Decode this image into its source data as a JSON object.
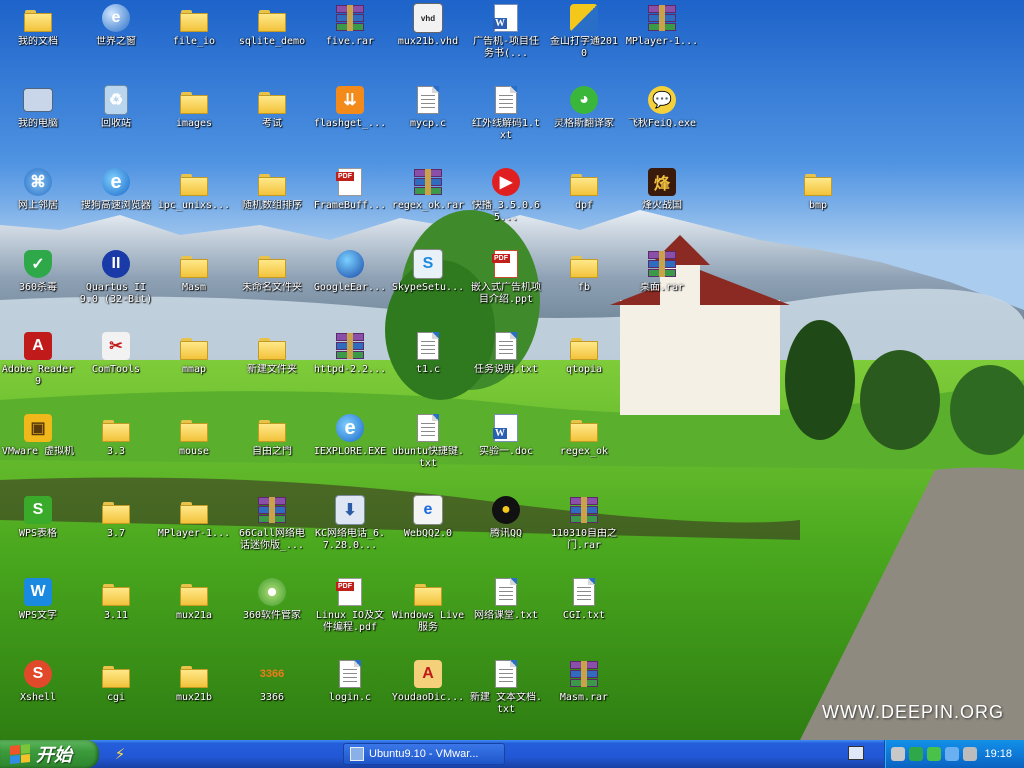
{
  "wallpaper": {
    "watermark": "WWW.DEEPIN.ORG"
  },
  "icons": [
    {
      "label": "我的文档",
      "kind": "mydocs"
    },
    {
      "label": "世界之窗",
      "kind": "browser-globe"
    },
    {
      "label": "file_io",
      "kind": "folder"
    },
    {
      "label": "sqlite_demo",
      "kind": "folder"
    },
    {
      "label": "five.rar",
      "kind": "rar"
    },
    {
      "label": "mux21b.vhd",
      "kind": "vhd"
    },
    {
      "label": "广告机-项目任务书(...",
      "kind": "word"
    },
    {
      "label": "金山打字通2010",
      "kind": "typing"
    },
    {
      "label": "MPlayer-1...",
      "kind": "rar"
    },
    {
      "label": "我的电脑",
      "kind": "computer"
    },
    {
      "label": "回收站",
      "kind": "recycle"
    },
    {
      "label": "images",
      "kind": "folder"
    },
    {
      "label": "考试",
      "kind": "folder"
    },
    {
      "label": "flashget_...",
      "kind": "flashget"
    },
    {
      "label": "mycp.c",
      "kind": "text"
    },
    {
      "label": "红外线解码1.txt",
      "kind": "text"
    },
    {
      "label": "灵格斯翻译家",
      "kind": "parrot"
    },
    {
      "label": "飞秋FeiQ.exe",
      "kind": "feiq"
    },
    {
      "label": "网上邻居",
      "kind": "network"
    },
    {
      "label": "搜狗高速浏览器",
      "kind": "ie"
    },
    {
      "label": "ipc_unixs...",
      "kind": "folder"
    },
    {
      "label": "随机数组排序",
      "kind": "folder"
    },
    {
      "label": "FrameBuff...",
      "kind": "pdf"
    },
    {
      "label": "regex_ok.rar",
      "kind": "rar"
    },
    {
      "label": "快播_3.5.0.65...",
      "kind": "qvod"
    },
    {
      "label": "dpf",
      "kind": "folder"
    },
    {
      "label": "烽火战国",
      "kind": "game"
    },
    {
      "label": "bmp",
      "kind": "folder"
    },
    {
      "label": "360杀毒",
      "kind": "shield"
    },
    {
      "label": "Quartus II 9.0 (32-Bit)",
      "kind": "quartus"
    },
    {
      "label": "Masm",
      "kind": "folder"
    },
    {
      "label": "未命名文件夹",
      "kind": "folder"
    },
    {
      "label": "GoogleEar...",
      "kind": "earth"
    },
    {
      "label": "SkypeSetu...",
      "kind": "skype"
    },
    {
      "label": "嵌入式广告机项目介绍.ppt",
      "kind": "ppt"
    },
    {
      "label": "fb",
      "kind": "folder"
    },
    {
      "label": "桌面.rar",
      "kind": "rar"
    },
    {
      "label": "Adobe Reader 9",
      "kind": "adobe"
    },
    {
      "label": "ComTools",
      "kind": "comtools"
    },
    {
      "label": "mmap",
      "kind": "folder"
    },
    {
      "label": "新建文件夹",
      "kind": "folder"
    },
    {
      "label": "httpd-2.2...",
      "kind": "rar"
    },
    {
      "label": "t1.c",
      "kind": "text"
    },
    {
      "label": "任务说明.txt",
      "kind": "text"
    },
    {
      "label": "qtopia",
      "kind": "folder"
    },
    {
      "label": "VMware 虚拟机",
      "kind": "vmware"
    },
    {
      "label": "3.3",
      "kind": "folder"
    },
    {
      "label": "mouse",
      "kind": "folder"
    },
    {
      "label": "自由之門",
      "kind": "folder"
    },
    {
      "label": "IEXPLORE.EXE",
      "kind": "ie"
    },
    {
      "label": "ubuntu快捷键.txt",
      "kind": "text"
    },
    {
      "label": "实验一.doc",
      "kind": "word"
    },
    {
      "label": "regex_ok",
      "kind": "folder"
    },
    {
      "label": "WPS表格",
      "kind": "wps-s"
    },
    {
      "label": "3.7",
      "kind": "folder"
    },
    {
      "label": "MPlayer-1...",
      "kind": "folder"
    },
    {
      "label": "66Call网络电话迷你版_...",
      "kind": "rar"
    },
    {
      "label": "KC网络电话_6.7.28.0...",
      "kind": "installer"
    },
    {
      "label": "WebQQ2.0",
      "kind": "webqq"
    },
    {
      "label": "腾讯QQ",
      "kind": "qq"
    },
    {
      "label": "110310自由之门.rar",
      "kind": "rar"
    },
    {
      "label": "WPS文字",
      "kind": "wps-w"
    },
    {
      "label": "3.11",
      "kind": "folder"
    },
    {
      "label": "mux21a",
      "kind": "folder"
    },
    {
      "label": "360软件管家",
      "kind": "cd"
    },
    {
      "label": "Linux IO及文件编程.pdf",
      "kind": "pdf"
    },
    {
      "label": "Windows Live 服务",
      "kind": "folder"
    },
    {
      "label": "网络课堂.txt",
      "kind": "text"
    },
    {
      "label": "CGI.txt",
      "kind": "text"
    },
    {
      "label": "Xshell",
      "kind": "xshell"
    },
    {
      "label": "cgi",
      "kind": "folder"
    },
    {
      "label": "mux21b",
      "kind": "folder"
    },
    {
      "label": "3366",
      "kind": "3366"
    },
    {
      "label": "login.c",
      "kind": "text"
    },
    {
      "label": "YoudaoDic...",
      "kind": "youdao"
    },
    {
      "label": "新建 文本文档.txt",
      "kind": "text"
    },
    {
      "label": "Masm.rar",
      "kind": "rar"
    }
  ],
  "taskbar": {
    "start_label": "开始",
    "task_item": "Ubuntu9.10 - VMwar...",
    "clock": "19:18"
  }
}
